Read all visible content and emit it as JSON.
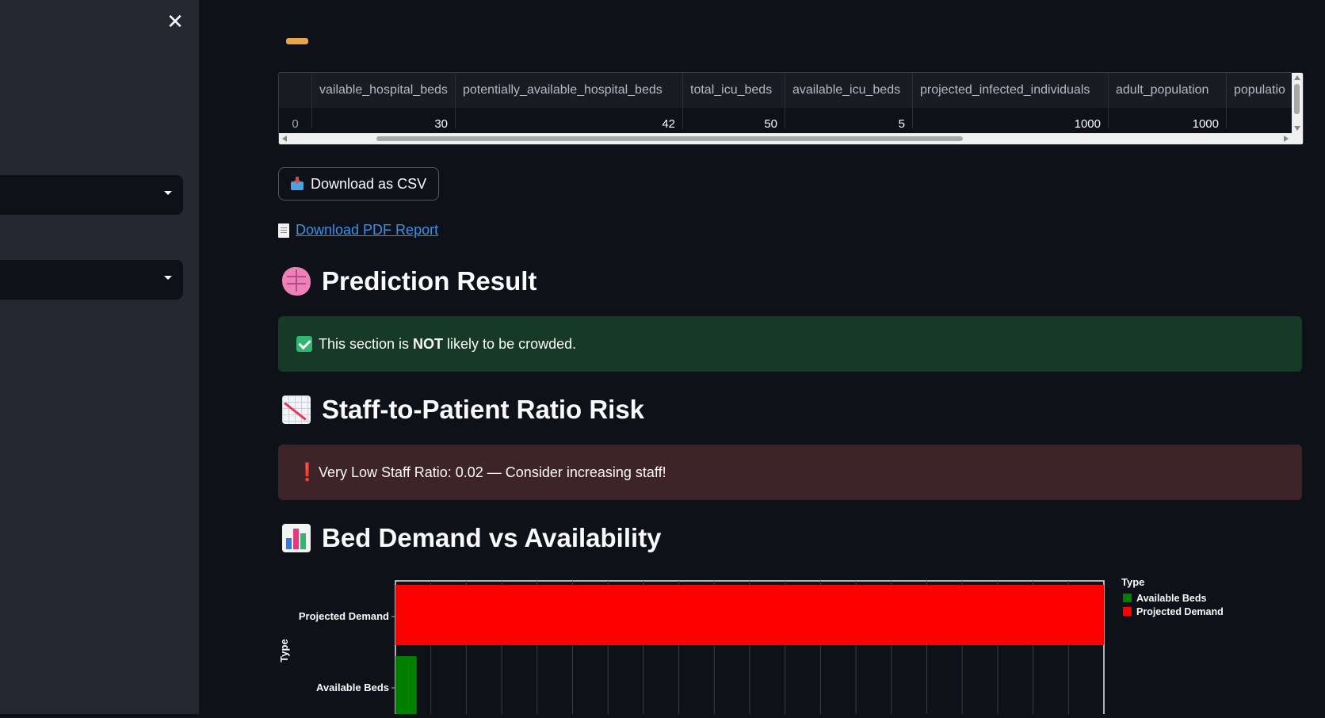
{
  "sidebar": {
    "close_icon": "close-icon",
    "selects": [
      {
        "value": ""
      },
      {
        "value": ""
      }
    ]
  },
  "dataframe": {
    "columns": [
      "",
      "vailable_hospital_beds",
      "potentially_available_hospital_beds",
      "total_icu_beds",
      "available_icu_beds",
      "projected_infected_individuals",
      "adult_population",
      "populatio"
    ],
    "rows": [
      [
        "0",
        "30",
        "42",
        "50",
        "5",
        "1000",
        "1000",
        ""
      ]
    ]
  },
  "download_csv": {
    "label": "Download as CSV",
    "icon": "inbox-tray-icon"
  },
  "download_pdf": {
    "label": " Download PDF Report",
    "icon": "page-icon"
  },
  "prediction": {
    "heading": "Prediction Result",
    "icon": "brain-icon",
    "message_pre": "This section is ",
    "message_bold": "NOT",
    "message_post": " likely to be crowded."
  },
  "staff": {
    "heading": "Staff-to-Patient Ratio Risk",
    "icon": "chart-decreasing-icon",
    "message": "Very Low Staff Ratio: 0.02 — Consider increasing staff!"
  },
  "bed_chart": {
    "heading": "Bed Demand vs Availability",
    "icon": "bar-chart-icon"
  },
  "chart_data": {
    "type": "bar",
    "orientation": "horizontal",
    "categories": [
      "Projected Demand",
      "Available Beds"
    ],
    "values": [
      1000,
      30
    ],
    "colors": {
      "Available Beds": "#008000",
      "Projected Demand": "#ff0000"
    },
    "ylabel": "Type",
    "xlabel": "",
    "xlim": [
      0,
      1000
    ],
    "grid": true,
    "legend": {
      "title": "Type",
      "placement": "right",
      "entries": [
        "Available Beds",
        "Projected Demand"
      ]
    }
  },
  "colors": {
    "background": "#0e1117",
    "sidebar": "#262730",
    "link": "#3d8fe8",
    "success_bg": "#173928",
    "error_bg": "#3e2428"
  }
}
